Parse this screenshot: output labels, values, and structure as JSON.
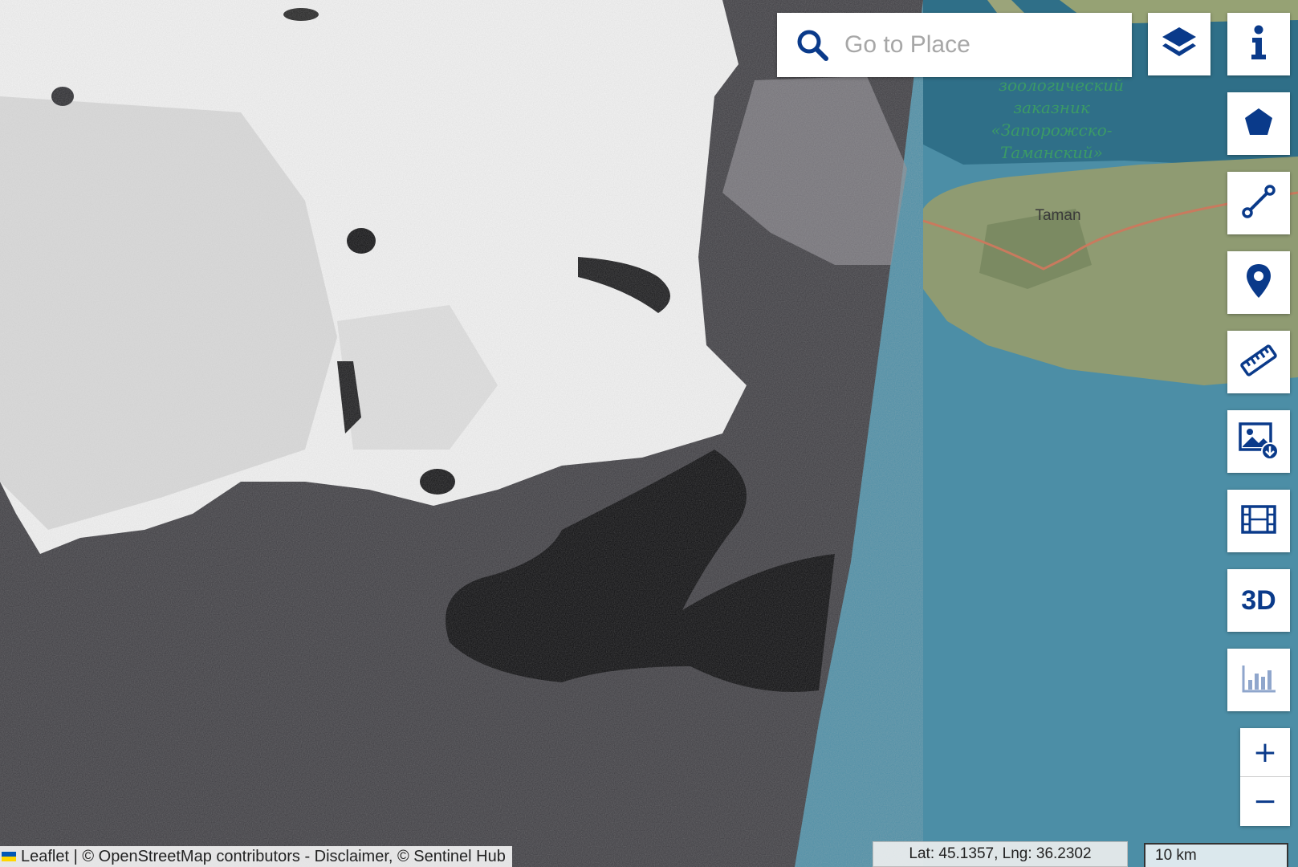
{
  "search": {
    "placeholder": "Go to Place"
  },
  "map_labels": {
    "reserve_lines": [
      "зоологический",
      "заказник",
      "«Запорожско-",
      "Таманский»"
    ],
    "town": "Taman"
  },
  "controls": [
    {
      "name": "info-button",
      "icon": "info-icon"
    },
    {
      "name": "draw-polygon-button",
      "icon": "pentagon-icon"
    },
    {
      "name": "draw-line-button",
      "icon": "line-icon"
    },
    {
      "name": "place-marker-button",
      "icon": "map-pin-icon"
    },
    {
      "name": "measure-button",
      "icon": "ruler-icon"
    },
    {
      "name": "image-download-button",
      "icon": "image-download-icon"
    },
    {
      "name": "timelapse-button",
      "icon": "film-icon"
    },
    {
      "name": "3d-button",
      "icon": "3d-icon",
      "label": "3D"
    },
    {
      "name": "histogram-button",
      "icon": "bar-chart-icon"
    }
  ],
  "zoom": {
    "in": "+",
    "out": "−"
  },
  "attribution": "Leaflet | © OpenStreetMap contributors - Disclaimer, © Sentinel Hub",
  "coordinates": "Lat: 45.1357, Lng: 36.2302",
  "scale": "10 km",
  "colors": {
    "accent": "#0a3a8a",
    "sea": "#4a8fa6",
    "sar_sea": "#3c3b40"
  }
}
